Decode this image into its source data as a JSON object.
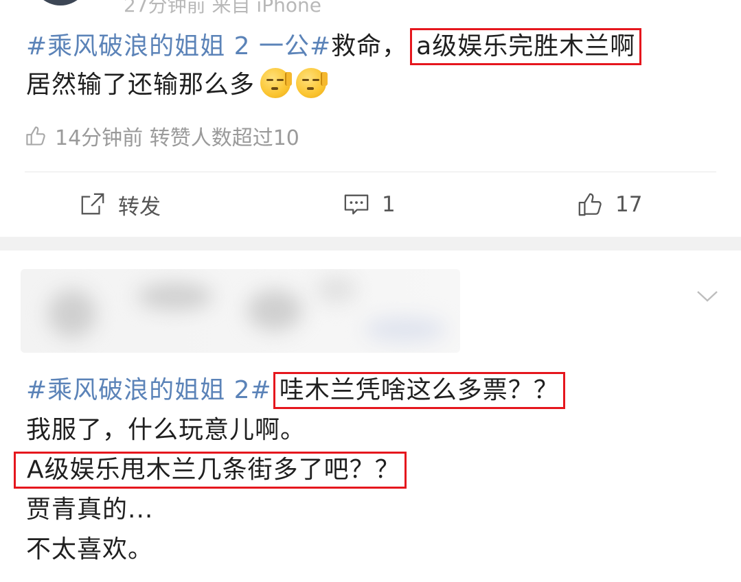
{
  "top": {
    "meta_partial": "27分钟前 来自 iPhone"
  },
  "post1": {
    "hashtag": "#乘风破浪的姐姐 2 一公#",
    "text_a": "救命，",
    "text_highlight": "a级娱乐完胜木兰啊",
    "text_b": "居然输了还输那么多",
    "emoji_count": 2,
    "like_icon": "thumbs-up-outline-icon",
    "meta": "14分钟前 转赞人数超过10"
  },
  "actions": {
    "repost_label": "转发",
    "comment_count": "1",
    "like_count": "17",
    "repost_icon": "share-icon",
    "comment_icon": "comment-icon",
    "like_icon": "thumbs-up-icon"
  },
  "post2": {
    "hashtag": "#乘风破浪的姐姐 2#",
    "highlight_1": "哇木兰凭啥这么多票？？",
    "line_2": "我服了，什么玩意儿啊。",
    "highlight_2": "A级娱乐甩木兰几条街多了吧？？",
    "line_4": "贾青真的...",
    "line_5": "不太喜欢。",
    "chevron_icon": "chevron-down-icon"
  },
  "colors": {
    "hashtag": "#5b83b8",
    "highlight_border": "#e5161d",
    "meta_gray": "#9a9a9a",
    "separator": "#f1f1f1"
  }
}
